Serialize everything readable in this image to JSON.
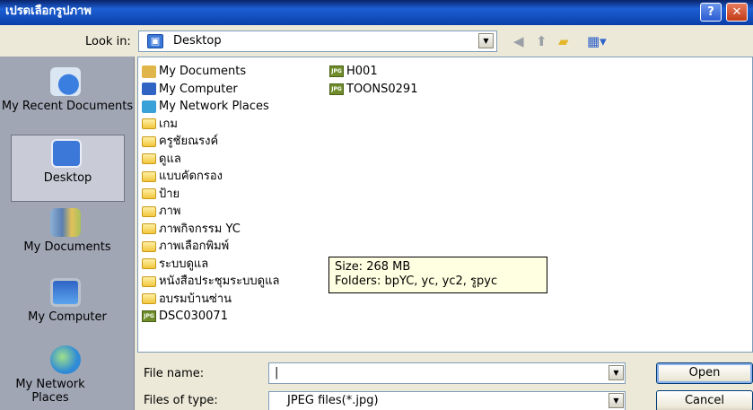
{
  "window": {
    "title": "เปรดเลือกรูปภาพ",
    "help_label": "?",
    "close_label": "✕"
  },
  "look_in": {
    "label": "Look in:",
    "value": "Desktop"
  },
  "places": [
    {
      "label": "My Recent Documents",
      "icon": "recent-documents-icon"
    },
    {
      "label": "Desktop",
      "icon": "desktop-icon"
    },
    {
      "label": "My Documents",
      "icon": "my-documents-icon"
    },
    {
      "label": "My Computer",
      "icon": "my-computer-icon"
    },
    {
      "label": "My Network Places",
      "icon": "network-places-icon"
    }
  ],
  "files_col1": [
    {
      "name": "My Documents",
      "type": "system"
    },
    {
      "name": "My Computer",
      "type": "system"
    },
    {
      "name": "My Network Places",
      "type": "system"
    },
    {
      "name": "เกม",
      "type": "folder"
    },
    {
      "name": "ครูชัยณรงค์",
      "type": "folder"
    },
    {
      "name": "ดูแล",
      "type": "folder"
    },
    {
      "name": "แบบคัดกรอง",
      "type": "folder"
    },
    {
      "name": "ป้าย",
      "type": "folder"
    },
    {
      "name": "ภาพ",
      "type": "folder"
    },
    {
      "name": "ภาพกิจกรรม YC",
      "type": "folder"
    },
    {
      "name": "ภาพเลือกพิมพ์",
      "type": "folder"
    },
    {
      "name": "ระบบดูแล",
      "type": "folder"
    },
    {
      "name": "หนังสือประชุมระบบดูแล",
      "type": "folder"
    },
    {
      "name": "อบรมบ้านซ่าน",
      "type": "folder"
    },
    {
      "name": "DSC030071",
      "type": "jpg"
    }
  ],
  "files_col2": [
    {
      "name": "H001",
      "type": "jpg"
    },
    {
      "name": "TOONS0291",
      "type": "jpg"
    }
  ],
  "tooltip": {
    "size": "Size: 268 MB",
    "folders": "Folders: bpYC, yc, yc2, รูpyc"
  },
  "file_name": {
    "label": "File name:",
    "value": "|"
  },
  "files_of_type": {
    "label": "Files of type:",
    "value": "JPEG files(*.jpg)"
  },
  "buttons": {
    "open": "Open",
    "cancel": "Cancel"
  },
  "colors": {
    "titlebar": "#0b3fa8",
    "places_bg": "#a1a6b5",
    "tooltip_bg": "#ffffe1"
  }
}
